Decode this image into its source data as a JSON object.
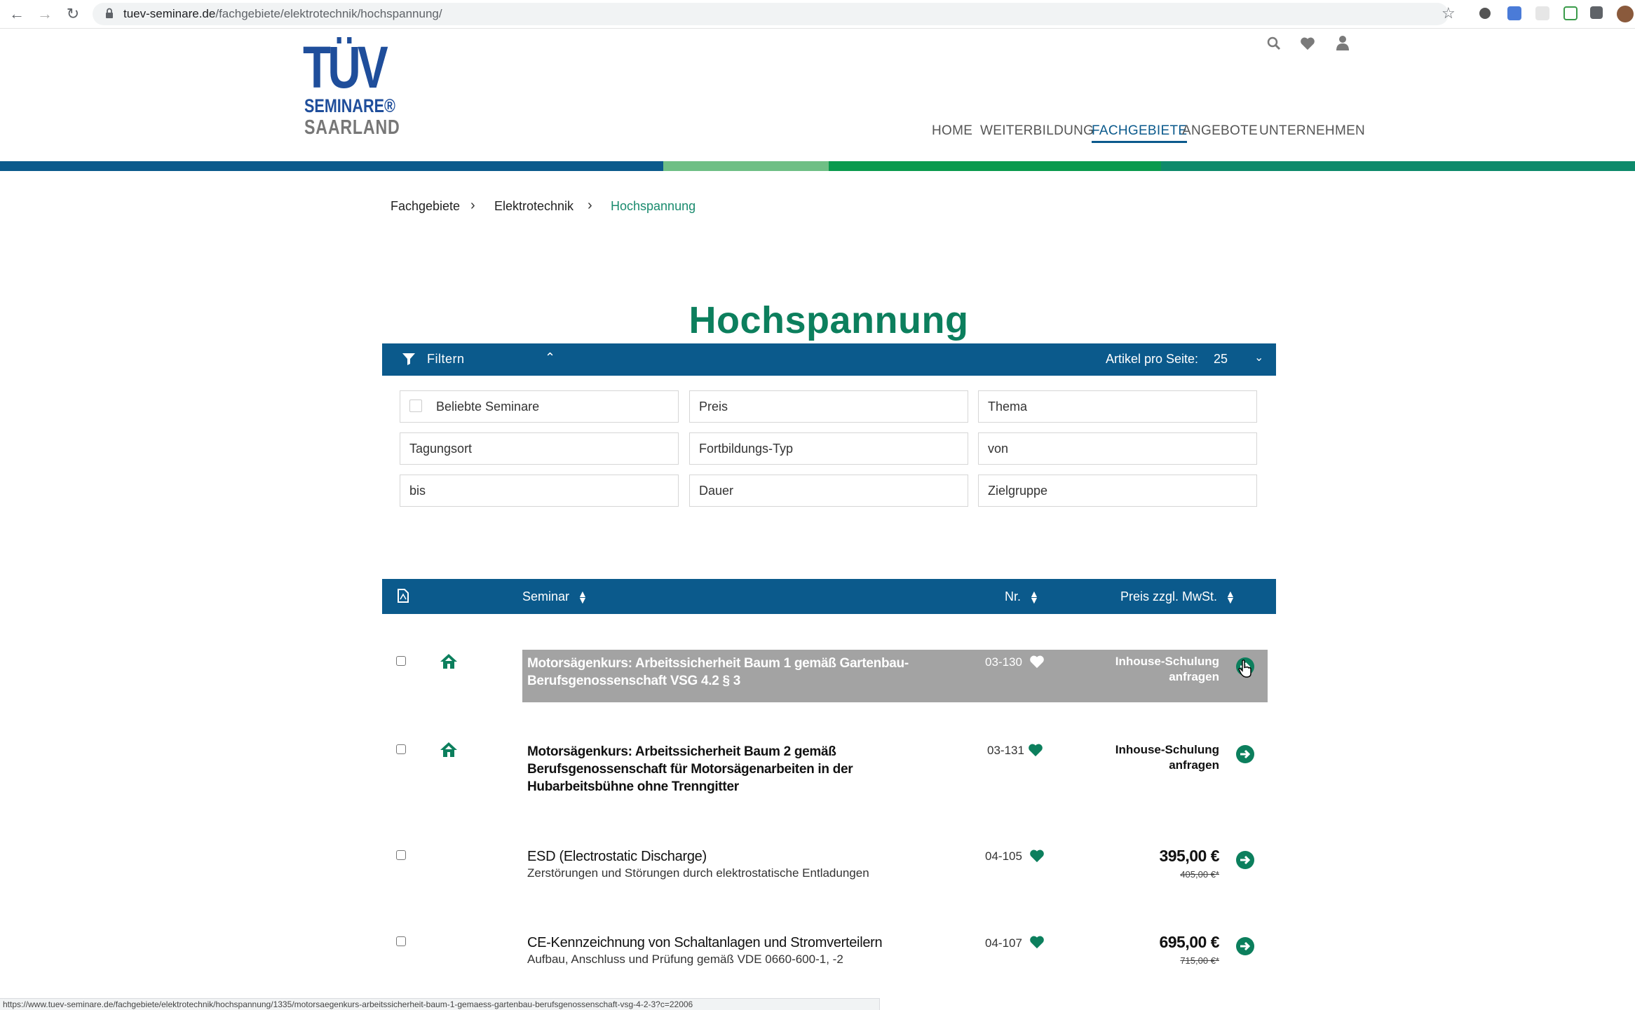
{
  "browser": {
    "url_domain": "tuev-seminare.de",
    "url_path": "/fachgebiete/elektrotechnik/hochspannung/",
    "status_url": "https://www.tuev-seminare.de/fachgebiete/elektrotechnik/hochspannung/1335/motorsaegenkurs-arbeitssicherheit-baum-1-gemaess-gartenbau-berufsgenossenschaft-vsg-4-2-3?c=22006"
  },
  "logo": {
    "line1": "TÜV",
    "line2": "SEMINARE®",
    "line3": "SAARLAND"
  },
  "nav": {
    "home": "HOME",
    "weiterbildung": "WEITERBILDUNG",
    "fachgebiete": "FACHGEBIETE",
    "angebote": "ANGEBOTE",
    "unternehmen": "UNTERNEHMEN"
  },
  "colors": {
    "brand_blue": "#0b5a8c",
    "brand_green": "#0c7f5d",
    "band_light_green": "#6fbf85",
    "band_green": "#0a9a4e",
    "band_teal": "#0e8a6b"
  },
  "breadcrumb": [
    "Fachgebiete",
    "Elektrotechnik",
    "Hochspannung"
  ],
  "page_title": "Hochspannung",
  "filter": {
    "label": "Filtern",
    "per_page_label": "Artikel pro Seite:",
    "per_page_value": "25",
    "fields": [
      "Beliebte Seminare",
      "Preis",
      "Thema",
      "Tagungsort",
      "Fortbildungs-Typ",
      "von",
      "bis",
      "Dauer",
      "Zielgruppe"
    ]
  },
  "table": {
    "col_seminar": "Seminar",
    "col_nr": "Nr.",
    "col_preis": "Preis zzgl. MwSt.",
    "rows": [
      {
        "title": "Motorsägenkurs: Arbeitssicherheit Baum 1 gemäß Gartenbau-Berufsgenossenschaft VSG 4.2 § 3",
        "nr": "03-130",
        "inhouse": "Inhouse-Schulung anfragen"
      },
      {
        "title": "Motorsägenkurs: Arbeitssicherheit Baum 2 gemäß Berufsgenossenschaft für Motorsägenarbeiten in der Hubarbeitsbühne ohne Trenngitter",
        "nr": "03-131",
        "inhouse": "Inhouse-Schulung anfragen"
      },
      {
        "title": "ESD (Electrostatic Discharge)",
        "subtitle": "Zerstörungen und Störungen durch elektrostatische Entladungen",
        "nr": "04-105",
        "price": "395,00 €",
        "old_price": "405,00 €*"
      },
      {
        "title": "CE-Kennzeichnung von Schaltanlagen und Stromverteilern",
        "subtitle": "Aufbau, Anschluss und Prüfung gemäß VDE 0660-600-1, -2",
        "nr": "04-107",
        "price": "695,00 €",
        "old_price": "715,00 €*"
      }
    ]
  }
}
